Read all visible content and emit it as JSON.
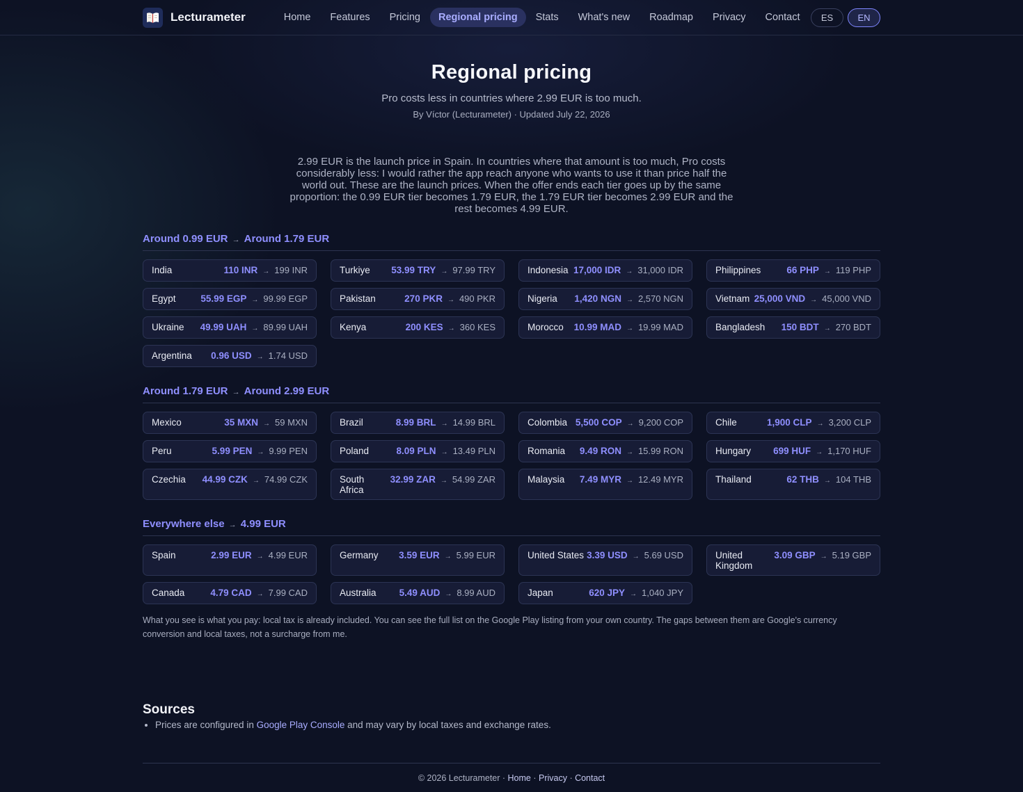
{
  "brand": {
    "name": "Lecturameter"
  },
  "nav": {
    "links": [
      {
        "label": "Home"
      },
      {
        "label": "Features"
      },
      {
        "label": "Pricing"
      },
      {
        "label": "Regional pricing",
        "active": true
      },
      {
        "label": "Stats"
      },
      {
        "label": "What's new"
      },
      {
        "label": "Roadmap"
      },
      {
        "label": "Privacy"
      },
      {
        "label": "Contact"
      }
    ],
    "languages": [
      {
        "label": "ES"
      },
      {
        "label": "EN",
        "active": true
      }
    ]
  },
  "hero": {
    "title": "Regional pricing",
    "subtitle": "Pro costs less in countries where 2.99 EUR is too much.",
    "meta": "By Víctor (Lecturameter) · Updated July 22, 2026"
  },
  "intro": "2.99 EUR is the launch price in Spain. In countries where that amount is too much, Pro costs considerably less: I would rather the app reach anyone who wants to use it than price half the world out. These are the launch prices. When the offer ends each tier goes up by the same proportion: the 0.99 EUR tier becomes 1.79 EUR, the 1.79 EUR tier becomes 2.99 EUR and the rest becomes 4.99 EUR.",
  "arrow_glyph": "→",
  "tiers": [
    {
      "from": "Around 0.99 EUR",
      "to": "Around 1.79 EUR",
      "items": [
        {
          "country": "India",
          "now": "110 INR",
          "later": "199 INR"
        },
        {
          "country": "Turkiye",
          "now": "53.99 TRY",
          "later": "97.99 TRY"
        },
        {
          "country": "Indonesia",
          "now": "17,000 IDR",
          "later": "31,000 IDR"
        },
        {
          "country": "Philippines",
          "now": "66 PHP",
          "later": "119 PHP"
        },
        {
          "country": "Egypt",
          "now": "55.99 EGP",
          "later": "99.99 EGP"
        },
        {
          "country": "Pakistan",
          "now": "270 PKR",
          "later": "490 PKR"
        },
        {
          "country": "Nigeria",
          "now": "1,420 NGN",
          "later": "2,570 NGN"
        },
        {
          "country": "Vietnam",
          "now": "25,000 VND",
          "later": "45,000 VND"
        },
        {
          "country": "Ukraine",
          "now": "49.99 UAH",
          "later": "89.99 UAH"
        },
        {
          "country": "Kenya",
          "now": "200 KES",
          "later": "360 KES"
        },
        {
          "country": "Morocco",
          "now": "10.99 MAD",
          "later": "19.99 MAD"
        },
        {
          "country": "Bangladesh",
          "now": "150 BDT",
          "later": "270 BDT"
        },
        {
          "country": "Argentina",
          "now": "0.96 USD",
          "later": "1.74 USD"
        }
      ]
    },
    {
      "from": "Around 1.79 EUR",
      "to": "Around 2.99 EUR",
      "items": [
        {
          "country": "Mexico",
          "now": "35 MXN",
          "later": "59 MXN"
        },
        {
          "country": "Brazil",
          "now": "8.99 BRL",
          "later": "14.99 BRL"
        },
        {
          "country": "Colombia",
          "now": "5,500 COP",
          "later": "9,200 COP"
        },
        {
          "country": "Chile",
          "now": "1,900 CLP",
          "later": "3,200 CLP"
        },
        {
          "country": "Peru",
          "now": "5.99 PEN",
          "later": "9.99 PEN"
        },
        {
          "country": "Poland",
          "now": "8.09 PLN",
          "later": "13.49 PLN"
        },
        {
          "country": "Romania",
          "now": "9.49 RON",
          "later": "15.99 RON"
        },
        {
          "country": "Hungary",
          "now": "699 HUF",
          "later": "1,170 HUF"
        },
        {
          "country": "Czechia",
          "now": "44.99 CZK",
          "later": "74.99 CZK"
        },
        {
          "country": "South Africa",
          "now": "32.99 ZAR",
          "later": "54.99 ZAR"
        },
        {
          "country": "Malaysia",
          "now": "7.49 MYR",
          "later": "12.49 MYR"
        },
        {
          "country": "Thailand",
          "now": "62 THB",
          "later": "104 THB"
        }
      ]
    },
    {
      "from": "Everywhere else",
      "to": "4.99 EUR",
      "items": [
        {
          "country": "Spain",
          "now": "2.99 EUR",
          "later": "4.99 EUR"
        },
        {
          "country": "Germany",
          "now": "3.59 EUR",
          "later": "5.99 EUR"
        },
        {
          "country": "United States",
          "now": "3.39 USD",
          "later": "5.69 USD"
        },
        {
          "country": "United Kingdom",
          "now": "3.09 GBP",
          "later": "5.19 GBP"
        },
        {
          "country": "Canada",
          "now": "4.79 CAD",
          "later": "7.99 CAD"
        },
        {
          "country": "Australia",
          "now": "5.49 AUD",
          "later": "8.99 AUD"
        },
        {
          "country": "Japan",
          "now": "620 JPY",
          "later": "1,040 JPY"
        }
      ]
    }
  ],
  "footnote": "What you see is what you pay: local tax is already included. You can see the full list on the Google Play listing from your own country. The gaps between them are Google's currency conversion and local taxes, not a surcharge from me.",
  "sources": {
    "title": "Sources",
    "item_prefix": "Prices are configured in ",
    "link_label": "Google Play Console",
    "item_suffix": " and may vary by local taxes and exchange rates."
  },
  "footer": {
    "copyright": "© 2026 Lecturameter",
    "sep": "·",
    "links": [
      {
        "label": "Home"
      },
      {
        "label": "Privacy"
      },
      {
        "label": "Contact"
      }
    ]
  }
}
